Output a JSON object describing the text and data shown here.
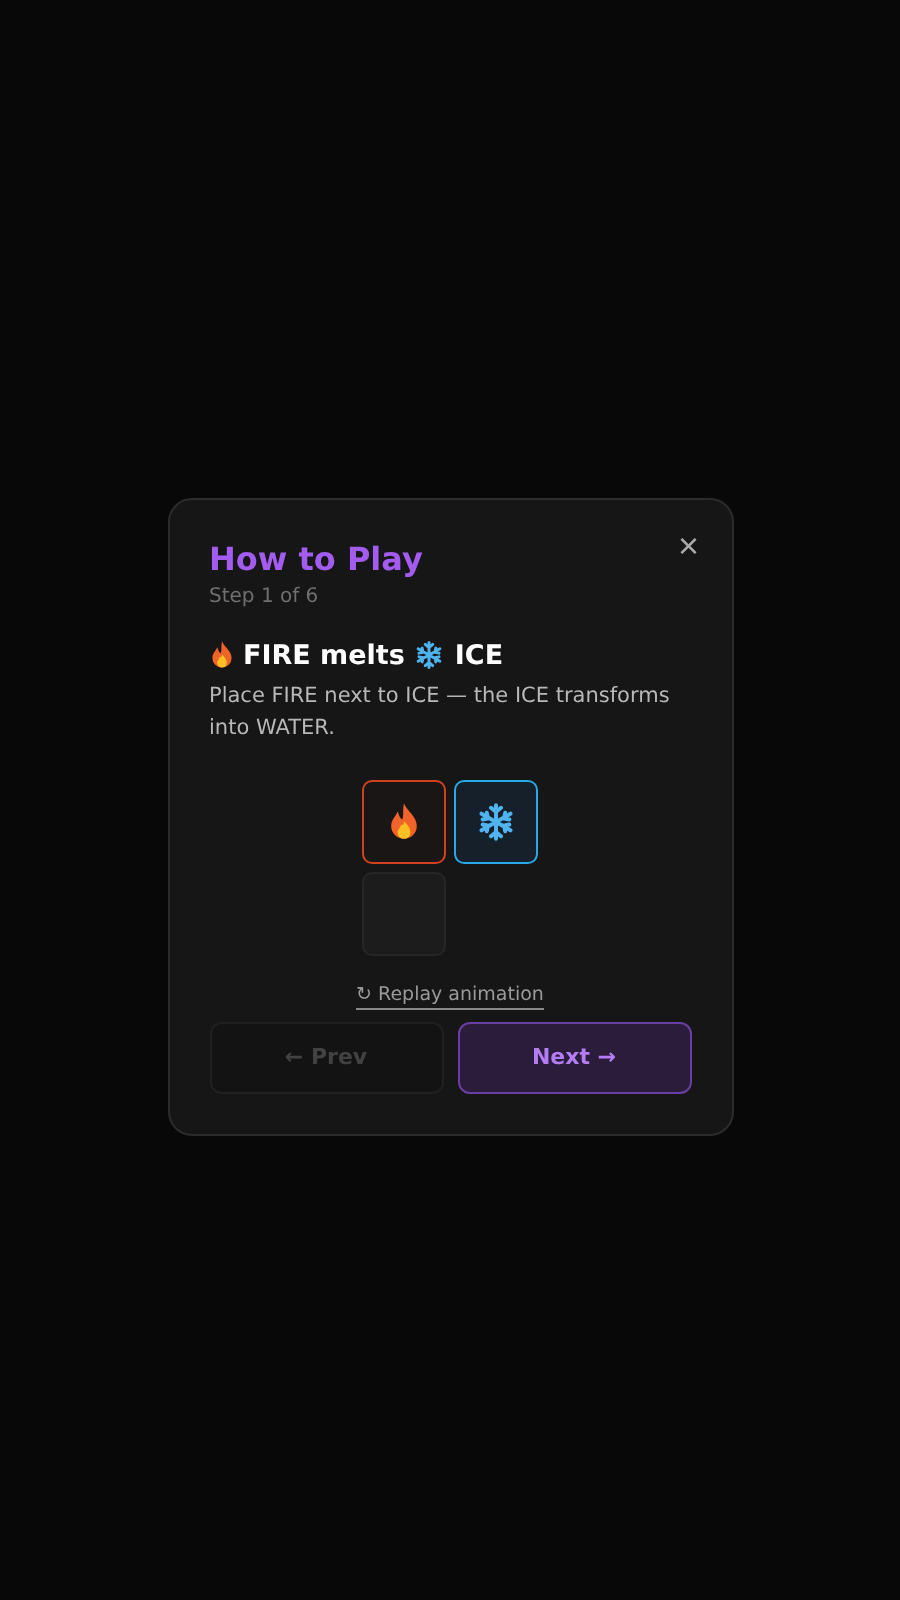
{
  "dialog": {
    "title": "How to Play",
    "close": "×",
    "step": "Step 1 of 6",
    "heading": [
      {
        "kind": "fire"
      },
      {
        "kind": "text",
        "text": "FIRE melts"
      },
      {
        "kind": "ice"
      },
      {
        "kind": "text",
        "text": "ICE"
      }
    ],
    "description": "Place FIRE next to ICE — the ICE transforms into WATER.",
    "board": [
      [
        {
          "kind": "fire"
        },
        {
          "kind": "ice"
        }
      ],
      [
        {
          "kind": "empty"
        }
      ]
    ],
    "replay": "↻ Replay animation",
    "buttons": [
      {
        "label": "← Prev",
        "disabled": true,
        "primary": false
      },
      {
        "label": "Next →",
        "disabled": false,
        "primary": true
      }
    ]
  }
}
